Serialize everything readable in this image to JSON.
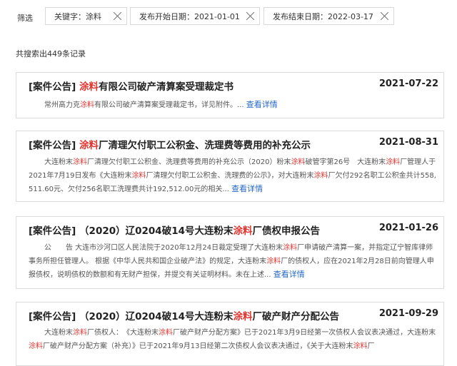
{
  "filters": {
    "label": "筛选",
    "chips": [
      {
        "text": "关键字：涂料"
      },
      {
        "text": "发布开始日期：2021-01-01"
      },
      {
        "text": "发布结束日期：2022-03-17"
      }
    ]
  },
  "result_count": "共搜索出449条记录",
  "more_label": "查看详情",
  "ellipsis": "...",
  "results": [
    {
      "tag": "[案件公告]",
      "title_pre": "",
      "keyword": "涂料",
      "title_post": "有限公司破产清算案受理裁定书",
      "date": "2021-07-22",
      "body": [
        {
          "t": "常州高力克",
          "h": false
        },
        {
          "t": "涂料",
          "h": true
        },
        {
          "t": "有限公司破产清算案受理裁定书，详见附件。",
          "h": false
        }
      ]
    },
    {
      "tag": "[案件公告]",
      "title_pre": "",
      "keyword": "涂料",
      "title_post": "厂清理欠付职工公积金、洗理费等费用的补充公示",
      "date": "2021-08-31",
      "body": [
        {
          "t": "大连粉末",
          "h": false
        },
        {
          "t": "涂料",
          "h": true
        },
        {
          "t": "厂清理欠付职工公积金、洗理费等费用的补充公示（2020）粉末",
          "h": false
        },
        {
          "t": "涂料",
          "h": true
        },
        {
          "t": "破管字第26号　大连粉末",
          "h": false
        },
        {
          "t": "涂料",
          "h": true
        },
        {
          "t": "厂管理人于2021年7月19日发布《大连粉末",
          "h": false
        },
        {
          "t": "涂料",
          "h": true
        },
        {
          "t": "厂清理欠付职工公积金、洗理费的公示》，对大连粉末",
          "h": false
        },
        {
          "t": "涂料",
          "h": true
        },
        {
          "t": "厂欠付292名职工公积金共计558,511.60元、欠付256名职工洗理费共计192,512.00元的相关",
          "h": false
        }
      ]
    },
    {
      "tag": "[案件公告]",
      "title_pre": "（2020）辽0204破14号大连粉末",
      "keyword": "涂料",
      "title_post": "厂债权申报公告",
      "date": "2021-01-26",
      "body": [
        {
          "t": "公　　告 大连市沙河口区人民法院于2020年12月24日裁定受理了大连粉末",
          "h": false
        },
        {
          "t": "涂料",
          "h": true
        },
        {
          "t": "厂申请破产清算一案，并指定辽宁智库律师事务所担任管理人。 根据《中华人民共和国企业破产法》的规定，大连粉末",
          "h": false
        },
        {
          "t": "涂料",
          "h": true
        },
        {
          "t": "厂的债权人，应在2021年2月28日前向管理人申报债权，说明债权的数额和有无财产担保，并提交有关证明材料。未在上述",
          "h": false
        }
      ]
    },
    {
      "tag": "[案件公告]",
      "title_pre": "（2020）辽0204破14号大连粉末",
      "keyword": "涂料",
      "title_post": "厂破产财产分配公告",
      "date": "2021-09-29",
      "body": [
        {
          "t": "大连粉末",
          "h": false
        },
        {
          "t": "涂料",
          "h": true
        },
        {
          "t": "厂债权人：　《大连粉末",
          "h": false
        },
        {
          "t": "涂料",
          "h": true
        },
        {
          "t": "厂破产财产分配方案》已于2021年3月9日经第一次债权人会议表决通过，大连粉末",
          "h": false
        },
        {
          "t": "涂料",
          "h": true
        },
        {
          "t": "厂破产财产分配方案（补充）》已于2021年9月13日经第二次债权人会议表决通过，《关于大连粉末",
          "h": false
        },
        {
          "t": "涂料",
          "h": true
        },
        {
          "t": "厂",
          "h": false
        }
      ]
    }
  ]
}
